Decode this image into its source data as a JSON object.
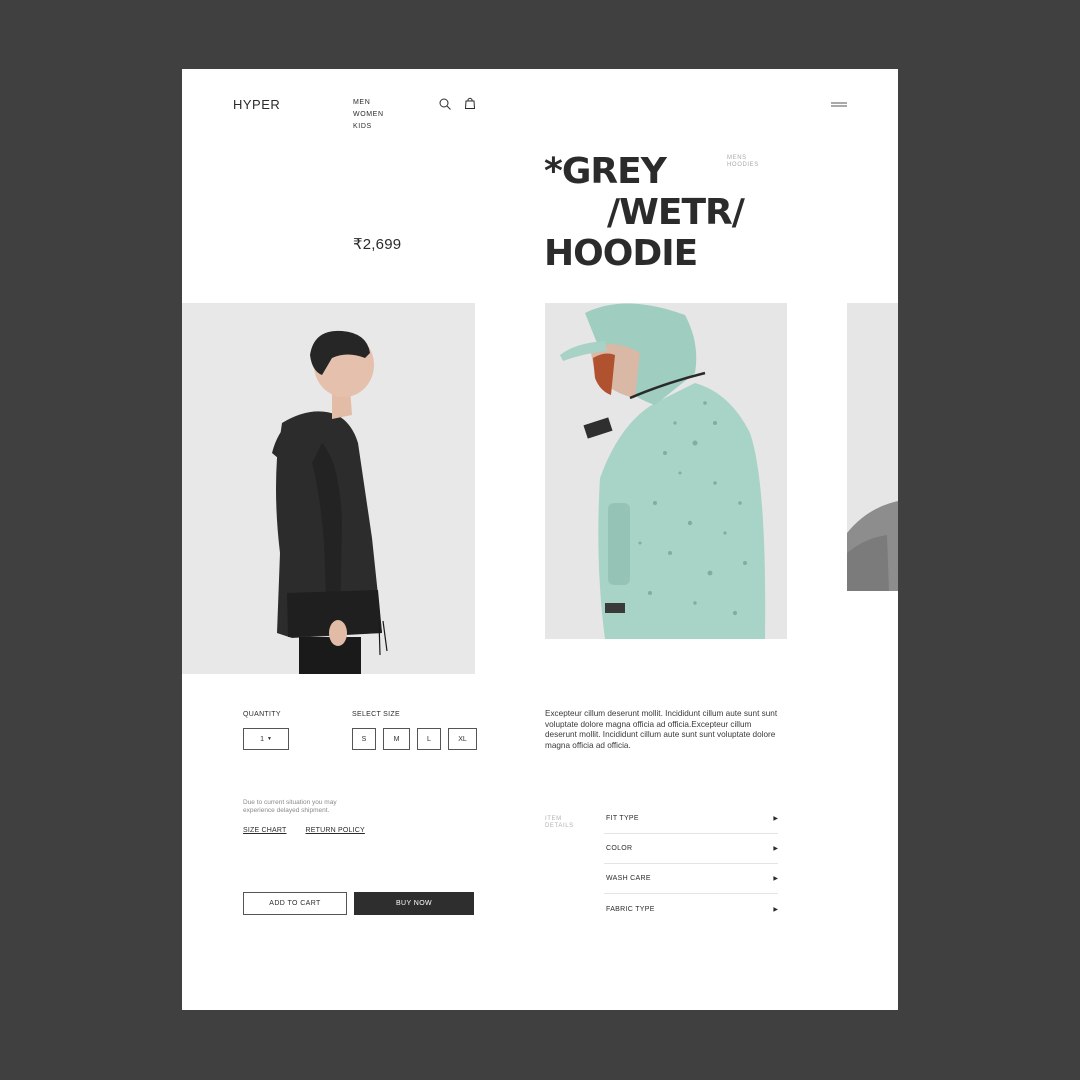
{
  "header": {
    "logo": "HYPER",
    "nav": [
      "MEN",
      "WOMEN",
      "KIDS"
    ],
    "icons": [
      "search-icon",
      "bag-icon",
      "menu-icon"
    ]
  },
  "product": {
    "title_lines": [
      "*GREY",
      "/WETR/",
      "HOODIE"
    ],
    "breadcrumb": [
      "MENS",
      "HOODIES"
    ],
    "price": "₹2,699",
    "description": "Excepteur cillum deserunt mollit. Incididunt cillum aute sunt sunt voluptate dolore magna officia ad officia.Excepteur cillum deserunt mollit. Incididunt cillum aute sunt sunt voluptate dolore magna officia ad officia."
  },
  "purchase": {
    "quantity_label": "QUANTITY",
    "quantity_value": "1",
    "size_label": "SELECT SIZE",
    "sizes": [
      "S",
      "M",
      "L",
      "XL"
    ],
    "notice": "Due to current situation you may experience delayed shipment.",
    "links": [
      "SIZE CHART",
      "RETURN POLICY"
    ],
    "add_to_cart": "ADD TO CART",
    "buy_now": "BUY NOW"
  },
  "details": {
    "label": [
      "ITEM",
      "DETAILS"
    ],
    "items": [
      "FIT TYPE",
      "COLOR",
      "WASH CARE",
      "FABRIC TYPE"
    ]
  },
  "colors": {
    "background": "#404040",
    "page": "#ffffff",
    "ink": "#2b2b2b",
    "muted": "#a9a9a9",
    "image_bg": "#e8e8e8",
    "jacket_mint": "#a9d4c8",
    "jacket_black": "#2c2c2c"
  }
}
